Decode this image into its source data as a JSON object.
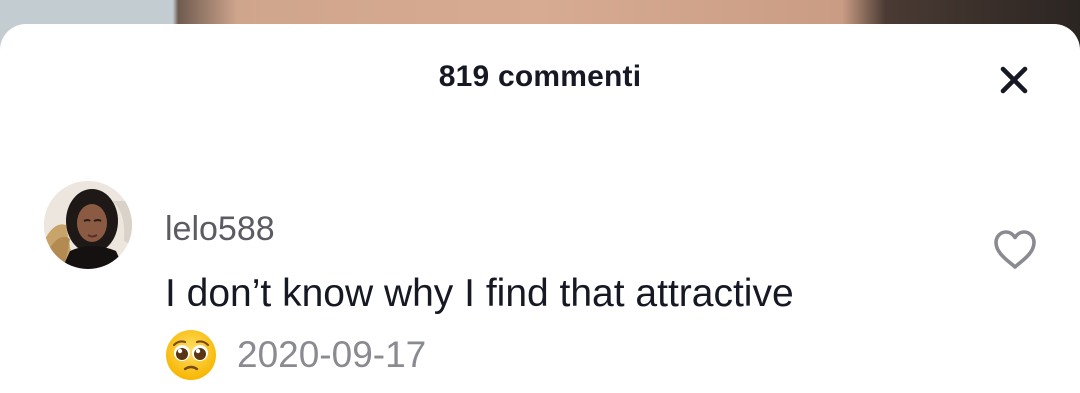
{
  "sheet": {
    "title": "819 commenti"
  },
  "icons": {
    "close": "close-icon",
    "like": "heart-outline-icon",
    "emoji": "pleading-face-emoji"
  },
  "comments": [
    {
      "username": "lelo588",
      "text": "I don’t know why I find that attractive",
      "date": "2020-09-17"
    }
  ]
}
